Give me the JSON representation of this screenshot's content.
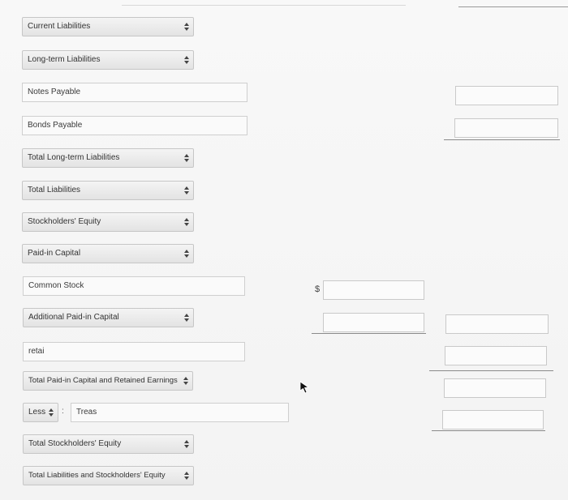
{
  "rows": {
    "current_liabilities": "Current Liabilities",
    "long_term_liabilities": "Long-term Liabilities",
    "notes_payable": "Notes Payable",
    "bonds_payable": "Bonds Payable",
    "total_long_term_liabilities": "Total Long-term Liabilities",
    "total_liabilities": "Total Liabilities",
    "stockholders_equity": "Stockholders' Equity",
    "paid_in_capital": "Paid-in Capital",
    "common_stock": "Common Stock",
    "additional_paid_in_capital": "Additional Paid-in Capital",
    "retai": "retai",
    "total_paid_in_and_retained": "Total Paid-in Capital and Retained Earnings",
    "less_select": "Less",
    "treas": "Treas",
    "total_stockholders_equity": "Total Stockholders' Equity",
    "total_liabilities_and_equity": "Total Liabilities and Stockholders' Equity"
  },
  "currency_symbol": "$",
  "colon": ":"
}
